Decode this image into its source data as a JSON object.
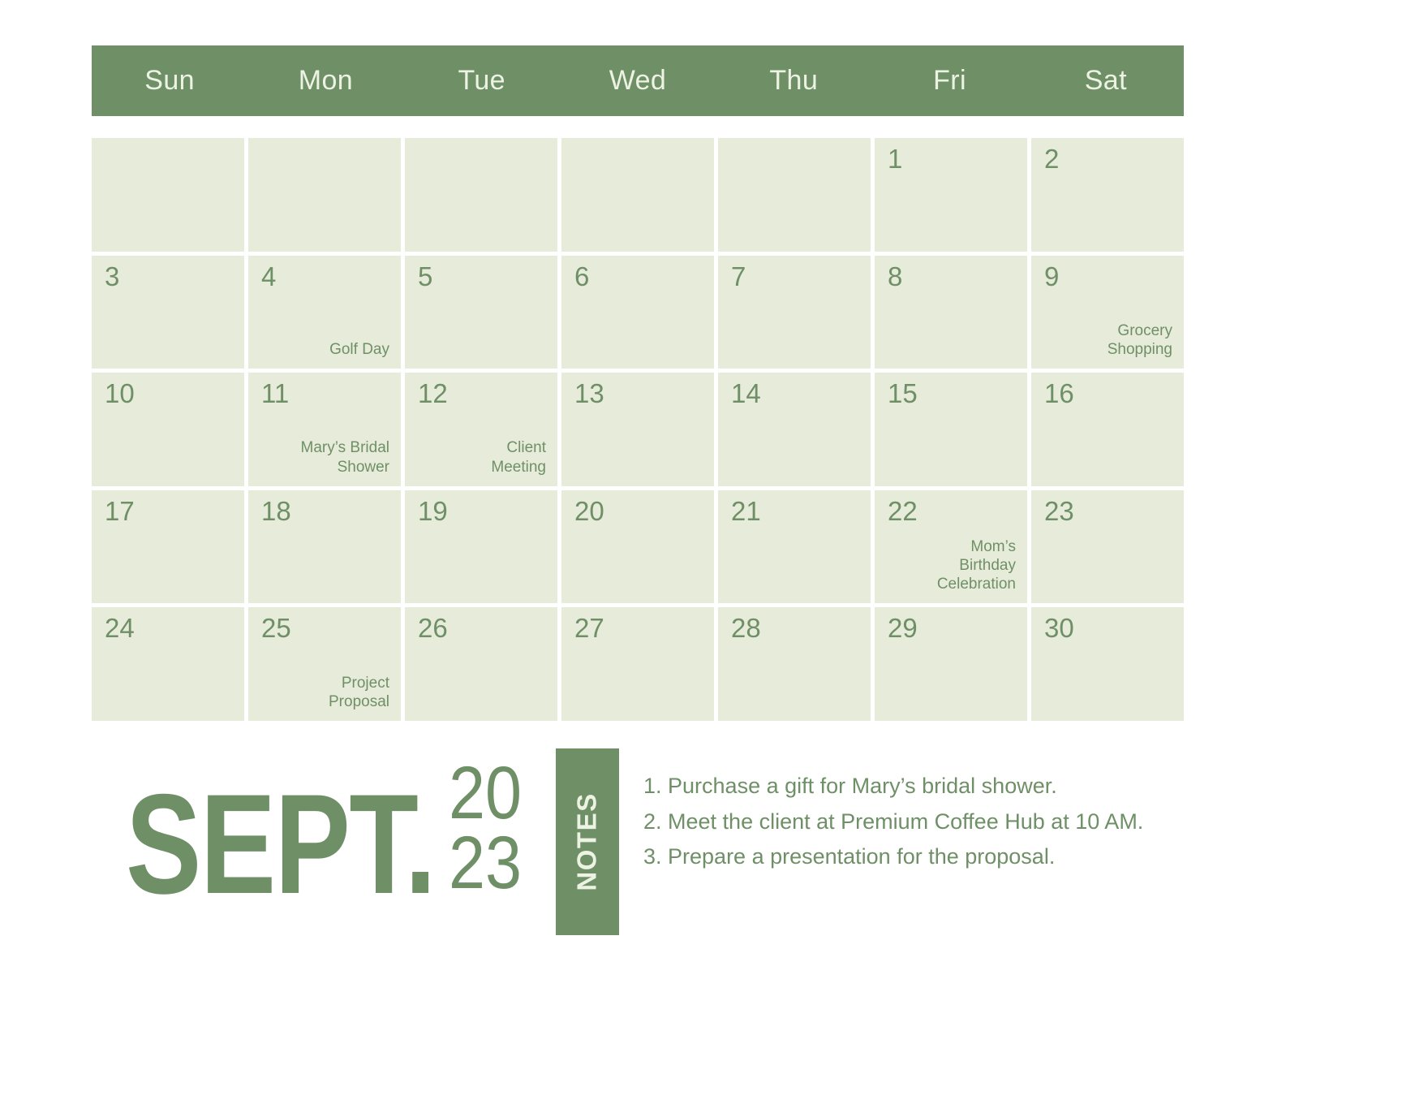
{
  "header": {
    "weekdays": [
      "Sun",
      "Mon",
      "Tue",
      "Wed",
      "Thu",
      "Fri",
      "Sat"
    ],
    "band_color": "#6f9067",
    "text_color": "#edf3e3"
  },
  "calendar": {
    "month_label": "SEPT.",
    "year_line_1": "20",
    "year_line_2": "23",
    "cell_color": "#e7ecda",
    "accent_color": "#6f9067",
    "weeks": [
      [
        {
          "day": "",
          "events": ""
        },
        {
          "day": "",
          "events": ""
        },
        {
          "day": "",
          "events": ""
        },
        {
          "day": "",
          "events": ""
        },
        {
          "day": "",
          "events": ""
        },
        {
          "day": "1",
          "events": ""
        },
        {
          "day": "2",
          "events": ""
        }
      ],
      [
        {
          "day": "3",
          "events": ""
        },
        {
          "day": "4",
          "events": "Golf Day"
        },
        {
          "day": "5",
          "events": ""
        },
        {
          "day": "6",
          "events": ""
        },
        {
          "day": "7",
          "events": ""
        },
        {
          "day": "8",
          "events": ""
        },
        {
          "day": "9",
          "events": "Grocery\nShopping"
        }
      ],
      [
        {
          "day": "10",
          "events": ""
        },
        {
          "day": "11",
          "events": "Mary’s Bridal\nShower"
        },
        {
          "day": "12",
          "events": "Client\nMeeting"
        },
        {
          "day": "13",
          "events": ""
        },
        {
          "day": "14",
          "events": ""
        },
        {
          "day": "15",
          "events": ""
        },
        {
          "day": "16",
          "events": ""
        }
      ],
      [
        {
          "day": "17",
          "events": ""
        },
        {
          "day": "18",
          "events": ""
        },
        {
          "day": "19",
          "events": ""
        },
        {
          "day": "20",
          "events": ""
        },
        {
          "day": "21",
          "events": ""
        },
        {
          "day": "22",
          "events": "Mom’s\nBirthday\nCelebration"
        },
        {
          "day": "23",
          "events": ""
        }
      ],
      [
        {
          "day": "24",
          "events": ""
        },
        {
          "day": "25",
          "events": "Project\nProposal"
        },
        {
          "day": "26",
          "events": ""
        },
        {
          "day": "27",
          "events": ""
        },
        {
          "day": "28",
          "events": ""
        },
        {
          "day": "29",
          "events": ""
        },
        {
          "day": "30",
          "events": ""
        }
      ]
    ]
  },
  "notes": {
    "tab_label": "NOTES",
    "items": [
      "1. Purchase a gift for Mary’s bridal shower.",
      "2. Meet the client at Premium Coffee Hub at 10 AM.",
      "3. Prepare a presentation for the proposal."
    ]
  }
}
